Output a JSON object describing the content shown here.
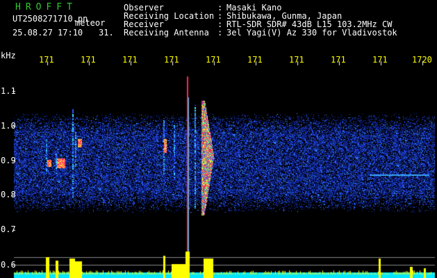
{
  "header": {
    "brand": "HROFFT",
    "filename": "UT2508271710.pn",
    "mode": "meteor",
    "timestamp": "25.08.27 17:10",
    "count": "31.",
    "fields": [
      {
        "label": "Observer",
        "value": "Masaki Kano"
      },
      {
        "label": "Receiving Location",
        "value": "Shibukawa, Gunma, Japan"
      },
      {
        "label": "Receiver",
        "value": "RTL-SDR SDR# 43dB L15 103.2MHz CW"
      },
      {
        "label": "Receiving Antenna",
        "value": "3el Yagi(V) Az 330 for Vladivostok"
      }
    ]
  },
  "axes": {
    "y_unit": "kHz",
    "y_ticks": [
      "1.1",
      "1.0",
      "0.9",
      "0.8",
      "0.7",
      "0.6"
    ],
    "x_ticks": [
      "171",
      "171",
      "171",
      "171",
      "171",
      "171",
      "171",
      "171",
      "171",
      "1720"
    ]
  },
  "colors": {
    "background": "#000000",
    "header_brand": "#33cc33",
    "axis_label": "#ffff00",
    "signal_peak": "#ff2a5a",
    "noise": "#1c3cff",
    "power_bars": "#ffff00",
    "power_baseline": "#00e5ff"
  }
}
